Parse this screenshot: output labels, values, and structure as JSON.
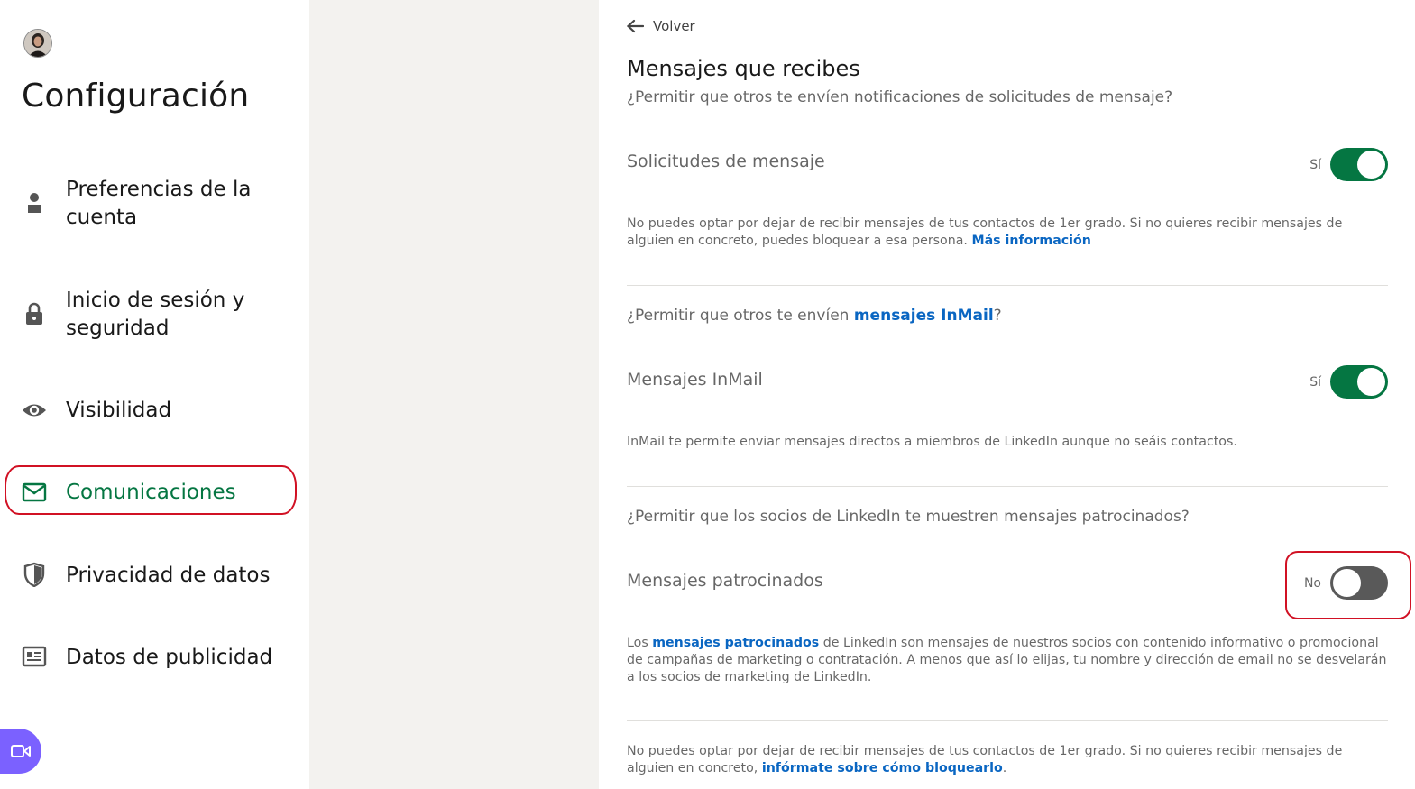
{
  "sidebar": {
    "title": "Configuración",
    "items": [
      {
        "label_line1": "Preferencias de la",
        "label_line2": "cuenta",
        "icon": "person-icon"
      },
      {
        "label_line1": "Inicio de sesión y",
        "label_line2": "seguridad",
        "icon": "lock-icon"
      },
      {
        "label": "Visibilidad",
        "icon": "eye-icon"
      },
      {
        "label": "Comunicaciones",
        "icon": "envelope-icon",
        "active": true
      },
      {
        "label": "Privacidad de datos",
        "icon": "shield-icon"
      },
      {
        "label": "Datos de publicidad",
        "icon": "newspaper-icon"
      }
    ]
  },
  "main": {
    "back_label": "Volver",
    "title": "Mensajes que recibes",
    "subtitle": "¿Permitir que otros te envíen notificaciones de solicitudes de mensaje?",
    "sections": [
      {
        "label": "Solicitudes de mensaje",
        "state": "Sí",
        "on": true,
        "desc_text": "No puedes optar por dejar de recibir mensajes de tus contactos de 1er grado. Si no quieres recibir mensajes de alguien en concreto, puedes bloquear a esa persona.",
        "desc_link": "Más información"
      },
      {
        "question_pre": "¿Permitir que otros te envíen ",
        "question_link": "mensajes InMail",
        "question_post": "?",
        "label": "Mensajes InMail",
        "state": "Sí",
        "on": true,
        "desc_text": "InMail te permite enviar mensajes directos a miembros de LinkedIn aunque no seáis contactos."
      },
      {
        "question": "¿Permitir que los socios de LinkedIn te muestren mensajes patrocinados?",
        "label": "Mensajes patrocinados",
        "state": "No",
        "on": false,
        "desc_pre": "Los ",
        "desc_link": "mensajes patrocinados",
        "desc_post": " de LinkedIn son mensajes de nuestros socios con contenido informativo o promocional de campañas de marketing o contratación. A menos que así lo elijas, tu nombre y dirección de email no se desvelarán a los socios de marketing de LinkedIn."
      }
    ],
    "footer_text": "No puedes optar por dejar de recibir mensajes de tus contactos de 1er grado. Si no quieres recibir mensajes de alguien en concreto,",
    "footer_link": "infórmate sobre cómo bloquearlo",
    "footer_end": "."
  },
  "colors": {
    "accent_green": "#057642",
    "link_blue": "#0a66c2",
    "highlight_red": "#d11124",
    "gutter_gray": "#f3f2ef"
  }
}
